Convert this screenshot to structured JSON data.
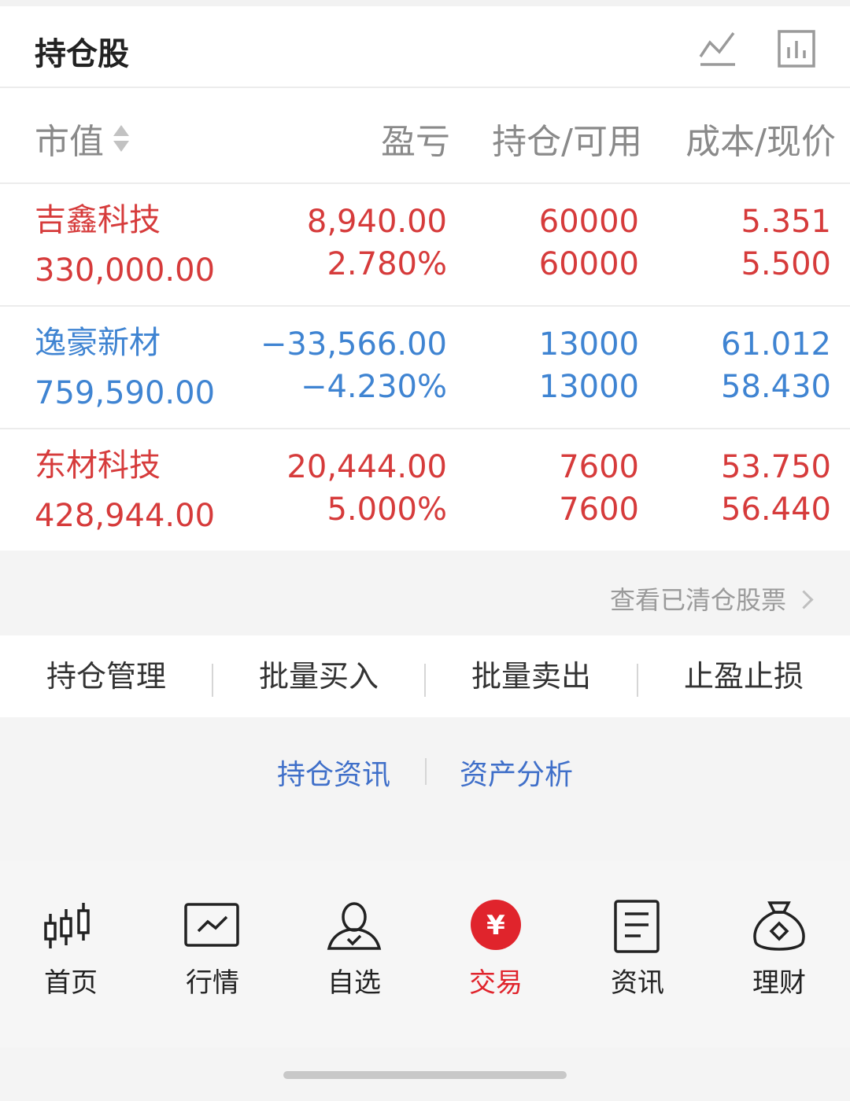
{
  "header": {
    "title": "持仓股",
    "trend_icon": "line-chart-icon",
    "bar_icon": "bar-chart-icon"
  },
  "columns": {
    "market_value": "市值",
    "pnl": "盈亏",
    "position": "持仓/可用",
    "cost_price": "成本/现价"
  },
  "rows": [
    {
      "name": "吉鑫科技",
      "value": "330,000.00",
      "pnl": "8,940.00",
      "pnl_pct": "2.780%",
      "hold": "60000",
      "avail": "60000",
      "cost": "5.351",
      "price": "5.500",
      "trend": "up"
    },
    {
      "name": "逸豪新材",
      "value": "759,590.00",
      "pnl": "−33,566.00",
      "pnl_pct": "−4.230%",
      "hold": "13000",
      "avail": "13000",
      "cost": "61.012",
      "price": "58.430",
      "trend": "down"
    },
    {
      "name": "东材科技",
      "value": "428,944.00",
      "pnl": "20,444.00",
      "pnl_pct": "5.000%",
      "hold": "7600",
      "avail": "7600",
      "cost": "53.750",
      "price": "56.440",
      "trend": "up"
    }
  ],
  "cleared_link": "查看已清仓股票",
  "actions": [
    "持仓管理",
    "批量买入",
    "批量卖出",
    "止盈止损"
  ],
  "info_links": [
    "持仓资讯",
    "资产分析"
  ],
  "tabs": [
    {
      "label": "首页",
      "icon": "candlestick-icon"
    },
    {
      "label": "行情",
      "icon": "market-chart-icon"
    },
    {
      "label": "自选",
      "icon": "user-star-icon"
    },
    {
      "label": "交易",
      "icon": "yuan-coin-icon",
      "active": true
    },
    {
      "label": "资讯",
      "icon": "document-icon"
    },
    {
      "label": "理财",
      "icon": "money-bag-icon"
    }
  ],
  "colors": {
    "up": "#d63b3b",
    "down": "#3f84d2",
    "accent": "#e0242c",
    "link": "#3f6fc9"
  }
}
